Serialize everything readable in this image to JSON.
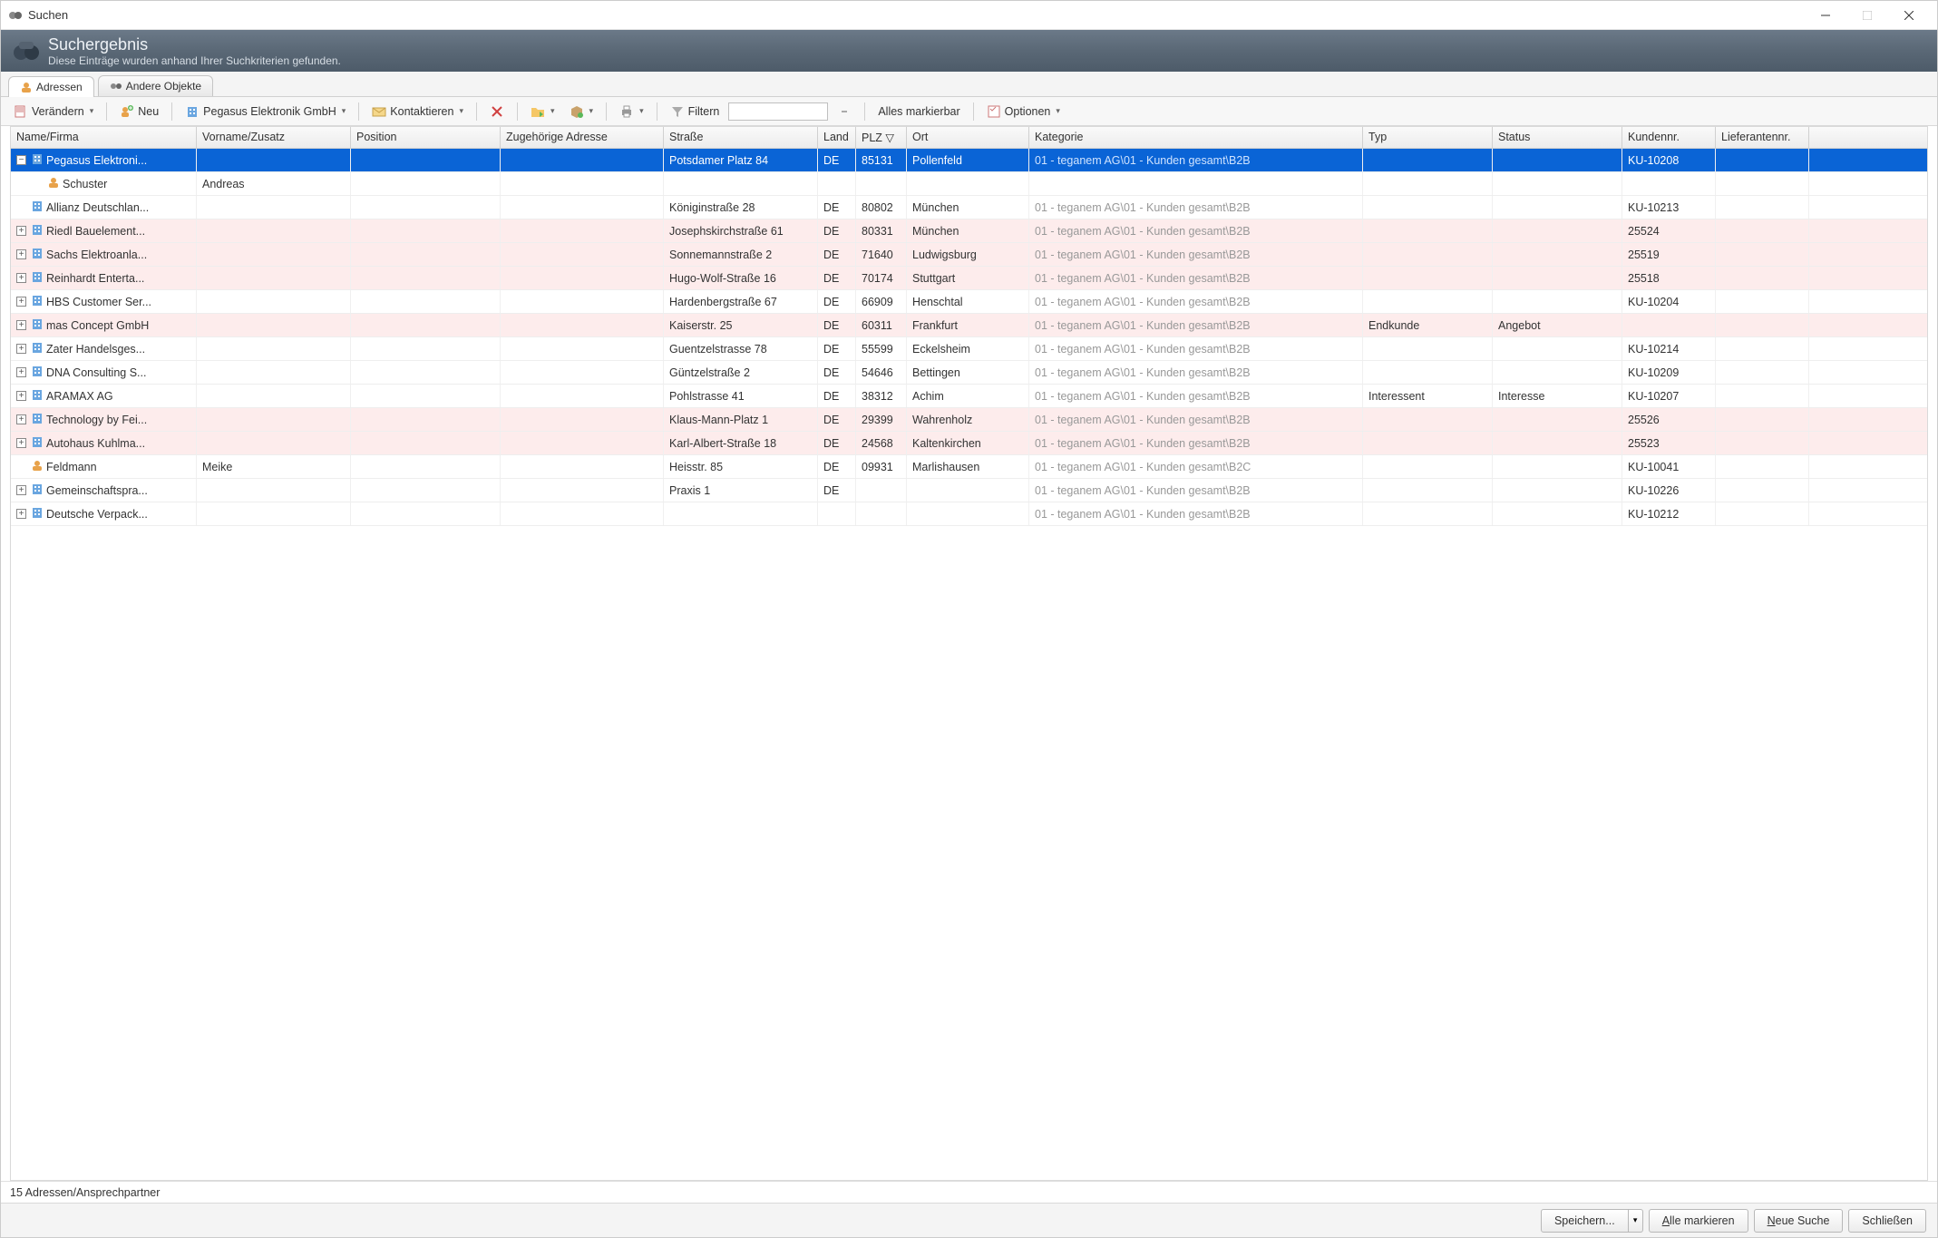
{
  "window": {
    "title": "Suchen"
  },
  "header": {
    "title": "Suchergebnis",
    "subtitle": "Diese Einträge wurden anhand Ihrer Suchkriterien gefunden."
  },
  "tabs": {
    "addresses": "Adressen",
    "other": "Andere Objekte"
  },
  "toolbar": {
    "change": "Verändern",
    "new": "Neu",
    "context": "Pegasus Elektronik GmbH",
    "contact": "Kontaktieren",
    "filter": "Filtern",
    "filter_value": "",
    "all_markable": "Alles markierbar",
    "options": "Optionen"
  },
  "columns": {
    "name": "Name/Firma",
    "vorname": "Vorname/Zusatz",
    "position": "Position",
    "zugeh": "Zugehörige Adresse",
    "strasse": "Straße",
    "land": "Land",
    "plz": "PLZ ▽",
    "ort": "Ort",
    "kat": "Kategorie",
    "typ": "Typ",
    "status": "Status",
    "kundennr": "Kundennr.",
    "lief": "Lieferantennr."
  },
  "rows": [
    {
      "selected": true,
      "pink": false,
      "expander": "-",
      "indent": 0,
      "icon": "company",
      "name": "Pegasus Elektroni...",
      "vorname": "",
      "position": "",
      "zugeh": "",
      "strasse": "Potsdamer Platz 84",
      "land": "DE",
      "plz": "85131",
      "ort": "Pollenfeld",
      "kat": "01 - teganem AG\\01 - Kunden gesamt\\B2B",
      "typ": "",
      "status": "",
      "kundennr": "KU-10208",
      "lief": ""
    },
    {
      "selected": false,
      "pink": false,
      "expander": "",
      "indent": 1,
      "icon": "person",
      "name": "Schuster",
      "vorname": "Andreas",
      "position": "",
      "zugeh": "",
      "strasse": "",
      "land": "",
      "plz": "",
      "ort": "",
      "kat": "",
      "typ": "",
      "status": "",
      "kundennr": "",
      "lief": ""
    },
    {
      "selected": false,
      "pink": false,
      "expander": "",
      "indent": 0,
      "icon": "company",
      "name": "Allianz Deutschlan...",
      "vorname": "",
      "position": "",
      "zugeh": "",
      "strasse": "Königinstraße 28",
      "land": "DE",
      "plz": "80802",
      "ort": "München",
      "kat": "01 - teganem AG\\01 - Kunden gesamt\\B2B",
      "typ": "",
      "status": "",
      "kundennr": "KU-10213",
      "lief": ""
    },
    {
      "selected": false,
      "pink": true,
      "expander": "+",
      "indent": 0,
      "icon": "company",
      "name": "Riedl Bauelement...",
      "vorname": "",
      "position": "",
      "zugeh": "",
      "strasse": "Josephskirchstraße 61",
      "land": "DE",
      "plz": "80331",
      "ort": "München",
      "kat": "01 - teganem AG\\01 - Kunden gesamt\\B2B",
      "typ": "",
      "status": "",
      "kundennr": "25524",
      "lief": ""
    },
    {
      "selected": false,
      "pink": true,
      "expander": "+",
      "indent": 0,
      "icon": "company",
      "name": "Sachs Elektroanla...",
      "vorname": "",
      "position": "",
      "zugeh": "",
      "strasse": "Sonnemannstraße 2",
      "land": "DE",
      "plz": "71640",
      "ort": "Ludwigsburg",
      "kat": "01 - teganem AG\\01 - Kunden gesamt\\B2B",
      "typ": "",
      "status": "",
      "kundennr": "25519",
      "lief": ""
    },
    {
      "selected": false,
      "pink": true,
      "expander": "+",
      "indent": 0,
      "icon": "company",
      "name": "Reinhardt Enterta...",
      "vorname": "",
      "position": "",
      "zugeh": "",
      "strasse": "Hugo-Wolf-Straße 16",
      "land": "DE",
      "plz": "70174",
      "ort": "Stuttgart",
      "kat": "01 - teganem AG\\01 - Kunden gesamt\\B2B",
      "typ": "",
      "status": "",
      "kundennr": "25518",
      "lief": ""
    },
    {
      "selected": false,
      "pink": false,
      "expander": "+",
      "indent": 0,
      "icon": "company",
      "name": "HBS Customer Ser...",
      "vorname": "",
      "position": "",
      "zugeh": "",
      "strasse": "Hardenbergstraße 67",
      "land": "DE",
      "plz": "66909",
      "ort": "Henschtal",
      "kat": "01 - teganem AG\\01 - Kunden gesamt\\B2B",
      "typ": "",
      "status": "",
      "kundennr": "KU-10204",
      "lief": ""
    },
    {
      "selected": false,
      "pink": true,
      "expander": "+",
      "indent": 0,
      "icon": "company",
      "name": "mas Concept GmbH",
      "vorname": "",
      "position": "",
      "zugeh": "",
      "strasse": "Kaiserstr. 25",
      "land": "DE",
      "plz": "60311",
      "ort": "Frankfurt",
      "kat": "01 - teganem AG\\01 - Kunden gesamt\\B2B",
      "typ": "Endkunde",
      "status": "Angebot",
      "kundennr": "",
      "lief": ""
    },
    {
      "selected": false,
      "pink": false,
      "expander": "+",
      "indent": 0,
      "icon": "company",
      "name": "Zater Handelsges...",
      "vorname": "",
      "position": "",
      "zugeh": "",
      "strasse": "Guentzelstrasse 78",
      "land": "DE",
      "plz": "55599",
      "ort": "Eckelsheim",
      "kat": "01 - teganem AG\\01 - Kunden gesamt\\B2B",
      "typ": "",
      "status": "",
      "kundennr": "KU-10214",
      "lief": ""
    },
    {
      "selected": false,
      "pink": false,
      "expander": "+",
      "indent": 0,
      "icon": "company",
      "name": "DNA Consulting S...",
      "vorname": "",
      "position": "",
      "zugeh": "",
      "strasse": "Güntzelstraße 2",
      "land": "DE",
      "plz": "54646",
      "ort": "Bettingen",
      "kat": "01 - teganem AG\\01 - Kunden gesamt\\B2B",
      "typ": "",
      "status": "",
      "kundennr": "KU-10209",
      "lief": ""
    },
    {
      "selected": false,
      "pink": false,
      "expander": "+",
      "indent": 0,
      "icon": "company",
      "name": "ARAMAX AG",
      "vorname": "",
      "position": "",
      "zugeh": "",
      "strasse": "Pohlstrasse 41",
      "land": "DE",
      "plz": "38312",
      "ort": "Achim",
      "kat": "01 - teganem AG\\01 - Kunden gesamt\\B2B",
      "typ": "Interessent",
      "status": "Interesse",
      "kundennr": "KU-10207",
      "lief": ""
    },
    {
      "selected": false,
      "pink": true,
      "expander": "+",
      "indent": 0,
      "icon": "company",
      "name": "Technology by Fei...",
      "vorname": "",
      "position": "",
      "zugeh": "",
      "strasse": "Klaus-Mann-Platz 1",
      "land": "DE",
      "plz": "29399",
      "ort": "Wahrenholz",
      "kat": "01 - teganem AG\\01 - Kunden gesamt\\B2B",
      "typ": "",
      "status": "",
      "kundennr": "25526",
      "lief": ""
    },
    {
      "selected": false,
      "pink": true,
      "expander": "+",
      "indent": 0,
      "icon": "company",
      "name": "Autohaus Kuhlma...",
      "vorname": "",
      "position": "",
      "zugeh": "",
      "strasse": "Karl-Albert-Straße 18",
      "land": "DE",
      "plz": "24568",
      "ort": "Kaltenkirchen",
      "kat": "01 - teganem AG\\01 - Kunden gesamt\\B2B",
      "typ": "",
      "status": "",
      "kundennr": "25523",
      "lief": ""
    },
    {
      "selected": false,
      "pink": false,
      "expander": "",
      "indent": 0,
      "icon": "person",
      "name": "Feldmann",
      "vorname": "Meike",
      "position": "",
      "zugeh": "",
      "strasse": "Heisstr. 85",
      "land": "DE",
      "plz": "09931",
      "ort": "Marlishausen",
      "kat": "01 - teganem AG\\01 - Kunden gesamt\\B2C",
      "typ": "",
      "status": "",
      "kundennr": "KU-10041",
      "lief": ""
    },
    {
      "selected": false,
      "pink": false,
      "expander": "+",
      "indent": 0,
      "icon": "company",
      "name": "Gemeinschaftspra...",
      "vorname": "",
      "position": "",
      "zugeh": "",
      "strasse": "Praxis 1",
      "land": "DE",
      "plz": "",
      "ort": "",
      "kat": "01 - teganem AG\\01 - Kunden gesamt\\B2B",
      "typ": "",
      "status": "",
      "kundennr": "KU-10226",
      "lief": ""
    },
    {
      "selected": false,
      "pink": false,
      "expander": "+",
      "indent": 0,
      "icon": "company",
      "name": "Deutsche Verpack...",
      "vorname": "",
      "position": "",
      "zugeh": "",
      "strasse": "",
      "land": "",
      "plz": "",
      "ort": "",
      "kat": "01 - teganem AG\\01 - Kunden gesamt\\B2B",
      "typ": "",
      "status": "",
      "kundennr": "KU-10212",
      "lief": ""
    }
  ],
  "status": "15 Adressen/Ansprechpartner",
  "buttons": {
    "save": "Speichern...",
    "mark_all": "Alle markieren",
    "new_search": "Neue Suche",
    "close": "Schließen"
  }
}
